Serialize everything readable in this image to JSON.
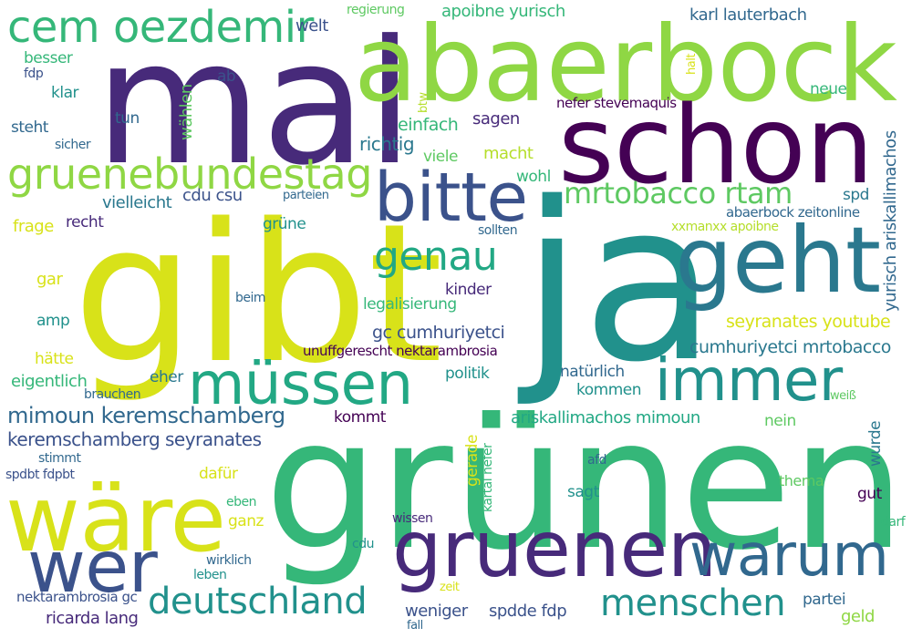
{
  "palette": {
    "dark_purple": "#440154",
    "indigo": "#472a7a",
    "blue_purple": "#3b528b",
    "slate_blue": "#31688e",
    "teal_blue": "#2a788e",
    "teal": "#21918c",
    "sea_green": "#22a884",
    "green": "#35b779",
    "light_green": "#5ec962",
    "yellow_green": "#8fd744",
    "lime": "#b5de2b",
    "yellow": "#d8e219"
  },
  "words": [
    {
      "text": "grünen",
      "color": "#35b779"
    },
    {
      "text": "ja",
      "color": "#21918c"
    },
    {
      "text": "gibt",
      "color": "#d8e219"
    },
    {
      "text": "mal",
      "color": "#472a7a"
    },
    {
      "text": "abaerbock",
      "color": "#8fd744"
    },
    {
      "text": "schon",
      "color": "#440154"
    },
    {
      "text": "wäre",
      "color": "#d8e219"
    },
    {
      "text": "gruenen",
      "color": "#472a7a"
    },
    {
      "text": "geht",
      "color": "#2a788e"
    },
    {
      "text": "bitte",
      "color": "#3b528b"
    },
    {
      "text": "müssen",
      "color": "#22a884"
    },
    {
      "text": "immer",
      "color": "#21918c"
    },
    {
      "text": "wer",
      "color": "#3b528b"
    },
    {
      "text": "warum",
      "color": "#31688e"
    },
    {
      "text": "cem oezdemir",
      "color": "#35b779"
    },
    {
      "text": "gruenebundestag",
      "color": "#8fd744"
    },
    {
      "text": "deutschland",
      "color": "#21918c"
    },
    {
      "text": "menschen",
      "color": "#21918c"
    },
    {
      "text": "genau",
      "color": "#22a884"
    },
    {
      "text": "mrtobacco rtam",
      "color": "#5ec962"
    },
    {
      "text": "mimoun keremschamberg",
      "color": "#31688e"
    },
    {
      "text": "keremschamberg seyranates",
      "color": "#3b528b"
    },
    {
      "text": "seyranates youtube",
      "color": "#d8e219"
    },
    {
      "text": "cumhuriyetci mrtobacco",
      "color": "#2a788e"
    },
    {
      "text": "gc cumhuriyetci",
      "color": "#3b528b"
    },
    {
      "text": "ariskallimachos mimoun",
      "color": "#22a884"
    },
    {
      "text": "karl lauterbach",
      "color": "#31688e"
    },
    {
      "text": "apoibne yurisch",
      "color": "#35b779"
    },
    {
      "text": "yurisch ariskallimachos",
      "color": "#31688e"
    },
    {
      "text": "abaerbock zeitonline",
      "color": "#31688e"
    },
    {
      "text": "xxmanxx apoibne",
      "color": "#b5de2b"
    },
    {
      "text": "nefer stevemaquis",
      "color": "#440154"
    },
    {
      "text": "unuffgerescht nektarambrosia",
      "color": "#440154"
    },
    {
      "text": "nektarambrosia gc",
      "color": "#3b528b"
    },
    {
      "text": "ricarda lang",
      "color": "#472a7a"
    },
    {
      "text": "spdde fdp",
      "color": "#3b528b"
    },
    {
      "text": "spdbt fdpbt",
      "color": "#3b528b"
    },
    {
      "text": "kartal nefer",
      "color": "#35b779"
    },
    {
      "text": "cdu csu",
      "color": "#3b528b"
    },
    {
      "text": "vielleicht",
      "color": "#2a788e"
    },
    {
      "text": "richtig",
      "color": "#2a788e"
    },
    {
      "text": "einfach",
      "color": "#35b779"
    },
    {
      "text": "sagen",
      "color": "#472a7a"
    },
    {
      "text": "macht",
      "color": "#b5de2b"
    },
    {
      "text": "viele",
      "color": "#5ec962"
    },
    {
      "text": "wohl",
      "color": "#35b779"
    },
    {
      "text": "spd",
      "color": "#2a788e"
    },
    {
      "text": "neue",
      "color": "#35b779"
    },
    {
      "text": "welt",
      "color": "#3b528b"
    },
    {
      "text": "ab",
      "color": "#3b528b"
    },
    {
      "text": "besser",
      "color": "#35b779"
    },
    {
      "text": "fdp",
      "color": "#3b528b"
    },
    {
      "text": "klar",
      "color": "#21918c"
    },
    {
      "text": "tun",
      "color": "#31688e"
    },
    {
      "text": "wählen",
      "color": "#5ec962"
    },
    {
      "text": "steht",
      "color": "#31688e"
    },
    {
      "text": "sicher",
      "color": "#31688e"
    },
    {
      "text": "btw",
      "color": "#b5de2b"
    },
    {
      "text": "halt",
      "color": "#d8e219"
    },
    {
      "text": "regierung",
      "color": "#5ec962"
    },
    {
      "text": "frage",
      "color": "#d8e219"
    },
    {
      "text": "recht",
      "color": "#472a7a"
    },
    {
      "text": "grüne",
      "color": "#21918c"
    },
    {
      "text": "parteien",
      "color": "#31688e"
    },
    {
      "text": "sollten",
      "color": "#31688e"
    },
    {
      "text": "gar",
      "color": "#d8e219"
    },
    {
      "text": "beim",
      "color": "#31688e"
    },
    {
      "text": "amp",
      "color": "#21918c"
    },
    {
      "text": "kinder",
      "color": "#472a7a"
    },
    {
      "text": "legalisierung",
      "color": "#35b779"
    },
    {
      "text": "hätte",
      "color": "#d8e219"
    },
    {
      "text": "eigentlich",
      "color": "#35b779"
    },
    {
      "text": "brauchen",
      "color": "#31688e"
    },
    {
      "text": "eher",
      "color": "#2a788e"
    },
    {
      "text": "politik",
      "color": "#21918c"
    },
    {
      "text": "natürlich",
      "color": "#31688e"
    },
    {
      "text": "kommen",
      "color": "#21918c"
    },
    {
      "text": "kommt",
      "color": "#440154"
    },
    {
      "text": "nein",
      "color": "#5ec962"
    },
    {
      "text": "weiß",
      "color": "#5ec962"
    },
    {
      "text": "stimmt",
      "color": "#31688e"
    },
    {
      "text": "dafür",
      "color": "#d8e219"
    },
    {
      "text": "eben",
      "color": "#35b779"
    },
    {
      "text": "ganz",
      "color": "#d8e219"
    },
    {
      "text": "gerade",
      "color": "#d8e219"
    },
    {
      "text": "afd",
      "color": "#31688e"
    },
    {
      "text": "thema",
      "color": "#5ec962"
    },
    {
      "text": "wurde",
      "color": "#2a788e"
    },
    {
      "text": "sagt",
      "color": "#21918c"
    },
    {
      "text": "gut",
      "color": "#440154"
    },
    {
      "text": "wissen",
      "color": "#472a7a"
    },
    {
      "text": "darf",
      "color": "#35b779"
    },
    {
      "text": "cdu",
      "color": "#21918c"
    },
    {
      "text": "wirklich",
      "color": "#31688e"
    },
    {
      "text": "leben",
      "color": "#21918c"
    },
    {
      "text": "zeit",
      "color": "#d8e219"
    },
    {
      "text": "weniger",
      "color": "#3b528b"
    },
    {
      "text": "fall",
      "color": "#31688e"
    },
    {
      "text": "partei",
      "color": "#31688e"
    },
    {
      "text": "geld",
      "color": "#8fd744"
    }
  ]
}
